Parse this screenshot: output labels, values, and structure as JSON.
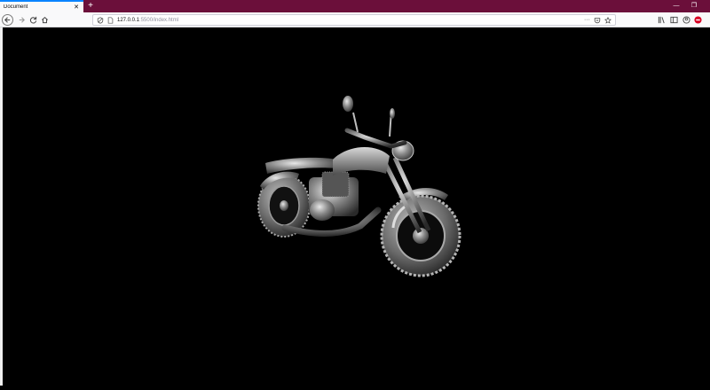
{
  "browser": {
    "tab_title": "Document",
    "tab_close": "✕",
    "new_tab": "+",
    "url_host": "127.0.0.1",
    "url_path": ":5500/index.html",
    "minimize": "—",
    "restore": "❐",
    "menu_dots": "···"
  },
  "colors": {
    "titlebar": "#6b0f3a",
    "accent": "#0a84ff",
    "addon": "#d70022"
  },
  "scene": {
    "background": "#000000",
    "object": "motorcycle-3d-model"
  }
}
